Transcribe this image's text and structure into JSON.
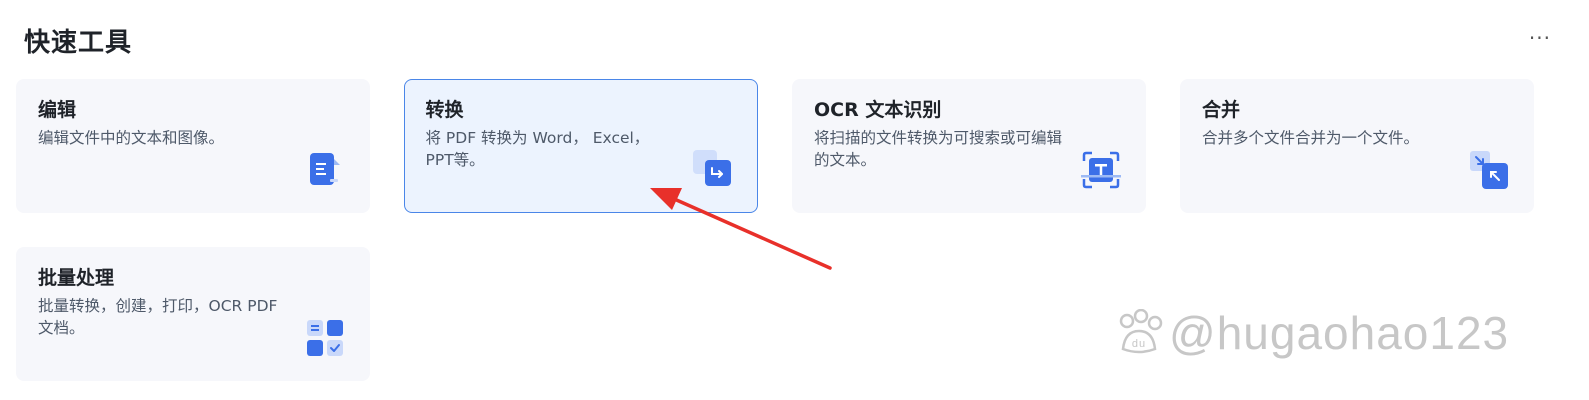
{
  "section": {
    "title": "快速工具",
    "more": "···"
  },
  "cards": [
    {
      "title": "编辑",
      "desc": "编辑文件中的文本和图像。",
      "icon": "edit-doc-icon"
    },
    {
      "title": "转换",
      "desc": "将 PDF 转换为 Word， Excel，PPT等。",
      "icon": "convert-icon",
      "selected": true
    },
    {
      "title": "OCR 文本识别",
      "desc": "将扫描的文件转换为可搜索或可编辑的文本。",
      "icon": "ocr-scan-icon"
    },
    {
      "title": "合并",
      "desc": "合并多个文件合并为一个文件。",
      "icon": "merge-icon"
    },
    {
      "title": "批量处理",
      "desc": "批量转换，创建，打印，OCR PDF 文档。",
      "icon": "batch-grid-icon"
    }
  ],
  "watermark": {
    "text": "@hugaohao123",
    "badge": "du"
  },
  "colors": {
    "accent": "#3b6fe8",
    "card_bg": "#f6f7fb",
    "selected_bg": "#ecf3fe",
    "selected_border": "#4a86e8",
    "annotation_arrow": "#e8302a"
  }
}
